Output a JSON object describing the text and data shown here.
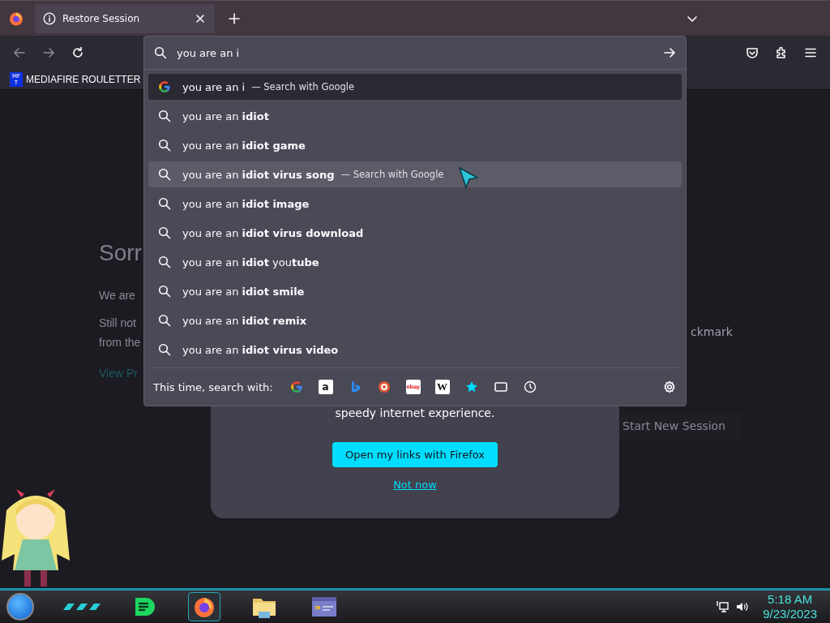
{
  "tabs": [
    {
      "title": "Restore Session",
      "selected": true
    }
  ],
  "urlbar": {
    "value": "you are an i"
  },
  "bookmarks": [
    {
      "label": "MEDIAFIRE ROULETTER",
      "badge": [
        "MF",
        "T"
      ]
    }
  ],
  "suggestions": [
    {
      "kind": "engine",
      "text": "you are an i",
      "action": "— Search with Google",
      "selected": true,
      "highlighted": false
    },
    {
      "kind": "search",
      "text": "you are an **idiot**",
      "selected": false,
      "highlighted": false
    },
    {
      "kind": "search",
      "text": "you are an **idiot game**",
      "selected": false,
      "highlighted": false
    },
    {
      "kind": "search",
      "text": "you are an **idiot virus song**",
      "action": "— Search with Google",
      "selected": false,
      "highlighted": true
    },
    {
      "kind": "search",
      "text": "you are an **idiot image**",
      "selected": false,
      "highlighted": false
    },
    {
      "kind": "search",
      "text": "you are an **idiot virus download**",
      "selected": false,
      "highlighted": false
    },
    {
      "kind": "search",
      "text": "you are an **idiot** you**tube**",
      "selected": false,
      "highlighted": false
    },
    {
      "kind": "search",
      "text": "you are an **idiot smile**",
      "selected": false,
      "highlighted": false
    },
    {
      "kind": "search",
      "text": "you are an **idiot remix**",
      "selected": false,
      "highlighted": false
    },
    {
      "kind": "search",
      "text": "you are an **idiot virus video**",
      "selected": false,
      "highlighted": false
    }
  ],
  "search_with": {
    "label": "This time, search with:",
    "engines": [
      {
        "kind": "google"
      },
      {
        "kind": "amazon",
        "glyph": "a"
      },
      {
        "kind": "bing"
      },
      {
        "kind": "duckduckgo"
      },
      {
        "kind": "ebay",
        "glyph": "ebay"
      },
      {
        "kind": "wikipedia",
        "glyph": "W"
      },
      {
        "kind": "bookmarks"
      },
      {
        "kind": "tabs"
      },
      {
        "kind": "history"
      }
    ]
  },
  "page": {
    "heading": "Sorr",
    "lines": [
      "We are",
      "Still not",
      "from the"
    ],
    "link": "View Pr",
    "right_text": "ckmark",
    "start_button": "Start New Session",
    "card": {
      "text": "speedy internet experience.",
      "primary_button": "Open my links with Firefox",
      "link": "Not now"
    }
  },
  "taskbar": {
    "apps": [
      {
        "kind": "chat",
        "active": false
      },
      {
        "kind": "firefox",
        "active": true
      },
      {
        "kind": "folder",
        "active": false
      },
      {
        "kind": "window",
        "active": false
      }
    ],
    "time": "5:18 AM",
    "date": "9/23/2023"
  }
}
